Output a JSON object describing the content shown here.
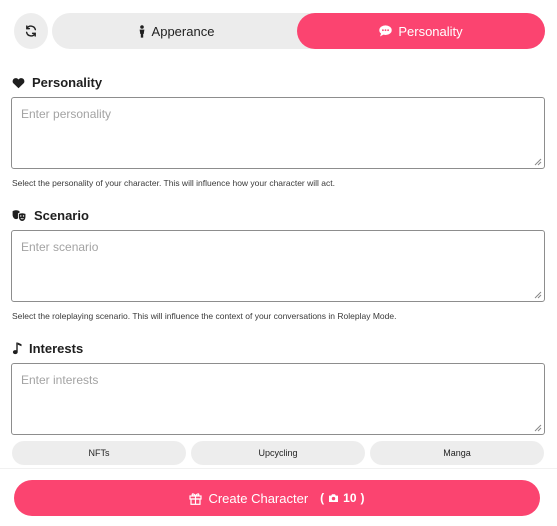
{
  "tabs": {
    "appearance_label": "Apperance",
    "personality_label": "Personality",
    "active_color": "#fb4470"
  },
  "sections": {
    "personality": {
      "title": "Personality",
      "placeholder": "Enter personality",
      "hint": "Select the personality of your character. This will influence how your character will act.",
      "icon": "heart-icon"
    },
    "scenario": {
      "title": "Scenario",
      "placeholder": "Enter scenario",
      "hint": "Select the roleplaying scenario. This will influence the context of your conversations in Roleplay Mode.",
      "icon": "theater-masks-icon"
    },
    "interests": {
      "title": "Interests",
      "placeholder": "Enter interests",
      "icon": "music-note-icon",
      "chips": [
        "NFTs",
        "Upcycling",
        "Manga"
      ]
    }
  },
  "create": {
    "label": "Create Character",
    "cost": "10",
    "icon": "gift-icon",
    "cost_icon": "camera-icon"
  }
}
